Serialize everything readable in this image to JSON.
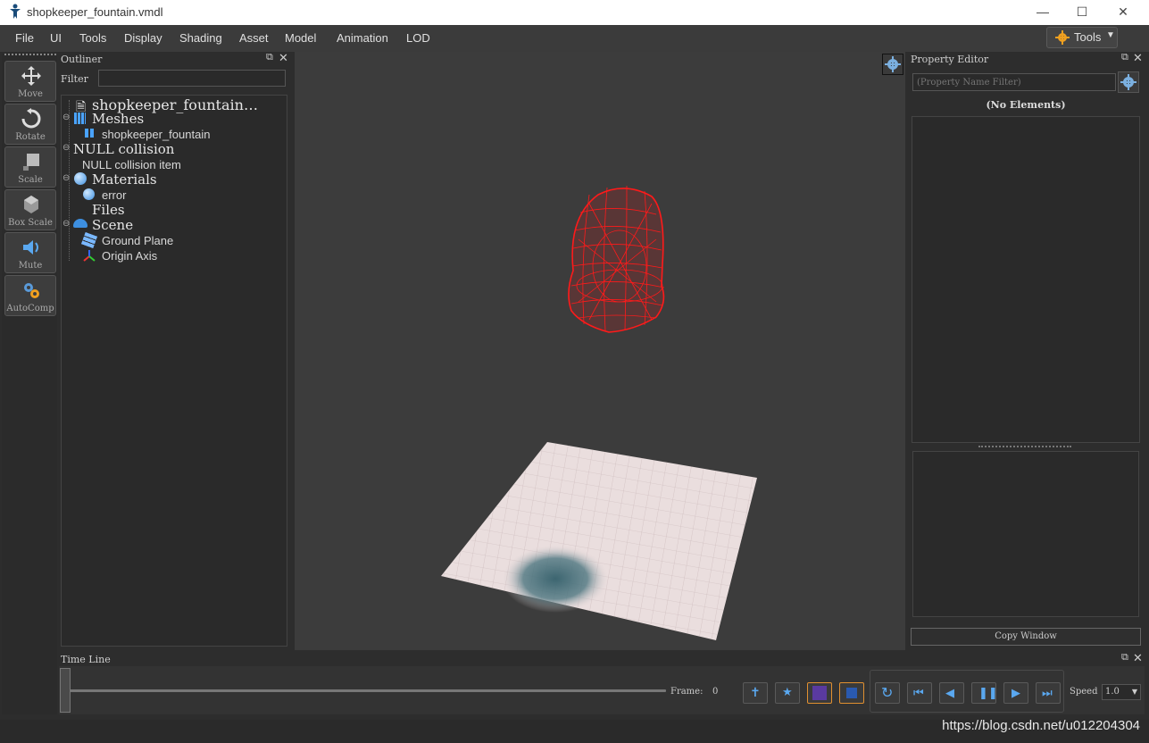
{
  "window": {
    "title": "shopkeeper_fountain.vmdl"
  },
  "menu": [
    "File",
    "UI",
    "Tools",
    "Display",
    "Shading",
    "Asset",
    "Model",
    "Animation",
    "LOD"
  ],
  "tools_dropdown": "Tools",
  "toolbar": {
    "move": "Move",
    "rotate": "Rotate",
    "scale": "Scale",
    "box_scale": "Box Scale",
    "mute": "Mute",
    "autocomp": "AutoComp"
  },
  "outliner": {
    "title": "Outliner",
    "filter_label": "Filter",
    "filter_value": "",
    "root": "shopkeeper_fountain…",
    "meshes": "Meshes",
    "mesh_item": "shopkeeper_fountain",
    "null_collision": "NULL collision",
    "null_collision_item": "NULL collision item",
    "materials": "Materials",
    "material_item": "error",
    "files": "Files",
    "scene": "Scene",
    "ground_plane": "Ground Plane",
    "origin_axis": "Origin Axis"
  },
  "property_editor": {
    "title": "Property Editor",
    "filter_placeholder": "(Property Name Filter)",
    "no_elements": "(No Elements)",
    "copy_window": "Copy Window"
  },
  "timeline": {
    "title": "Time Line",
    "frame_label": "Frame:",
    "frame_value": "0",
    "speed_label": "Speed",
    "speed_value": "1.0"
  },
  "watermark": "https://blog.csdn.net/u012204304",
  "colors": {
    "accent": "#4aa3ff",
    "wireframe": "#ff1a1a",
    "viewport": "#3c3c3c",
    "panel": "#2d2d2d"
  }
}
